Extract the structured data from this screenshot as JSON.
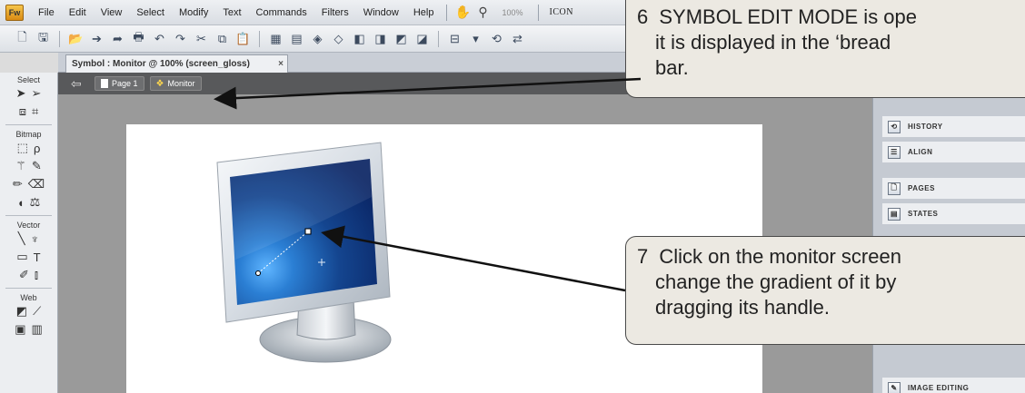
{
  "app": {
    "logo_text": "Fw",
    "menus": [
      "File",
      "Edit",
      "View",
      "Select",
      "Modify",
      "Text",
      "Commands",
      "Filters",
      "Window",
      "Help"
    ],
    "zoom": "100%",
    "right_label": "ICON"
  },
  "toolbar": {
    "icons": [
      "new-icon",
      "save-icon",
      "open-icon",
      "import-icon",
      "export-icon",
      "print-icon",
      "undo-icon",
      "redo-icon",
      "cut-icon",
      "copy-icon",
      "paste-icon",
      "group-icon",
      "ungroup-icon",
      "join-icon",
      "split-icon",
      "bring-front-icon",
      "bring-forward-icon",
      "send-backward-icon",
      "send-back-icon",
      "align-icon",
      "align-dropdown-icon",
      "rotate-icon",
      "flip-icon"
    ]
  },
  "document": {
    "tab_title": "Symbol : Monitor @ 100% (screen_gloss)",
    "tab_close": "×"
  },
  "breadcrumb": {
    "page": "Page 1",
    "symbol": "Monitor"
  },
  "tools": {
    "categories": [
      "Select",
      "Bitmap",
      "Vector",
      "Web"
    ]
  },
  "panels": {
    "items": [
      "HISTORY",
      "ALIGN",
      "PAGES",
      "STATES",
      "IMAGE EDITING"
    ]
  },
  "callouts": {
    "c6_num": "6",
    "c6_line1": "SYMBOL EDIT MODE is ope",
    "c6_line2": "it is displayed in the ‘bread",
    "c6_line3": "bar.",
    "c7_num": "7",
    "c7_line1": "Click on the monitor screen",
    "c7_line2": "change the gradient of it by",
    "c7_line3": "dragging its handle."
  },
  "colors": {
    "screen_dark": "#0d2a6b",
    "screen_light": "#3b8fe0",
    "breadcrumb_bg": "#58595b",
    "callout_bg": "#ece9e2"
  }
}
